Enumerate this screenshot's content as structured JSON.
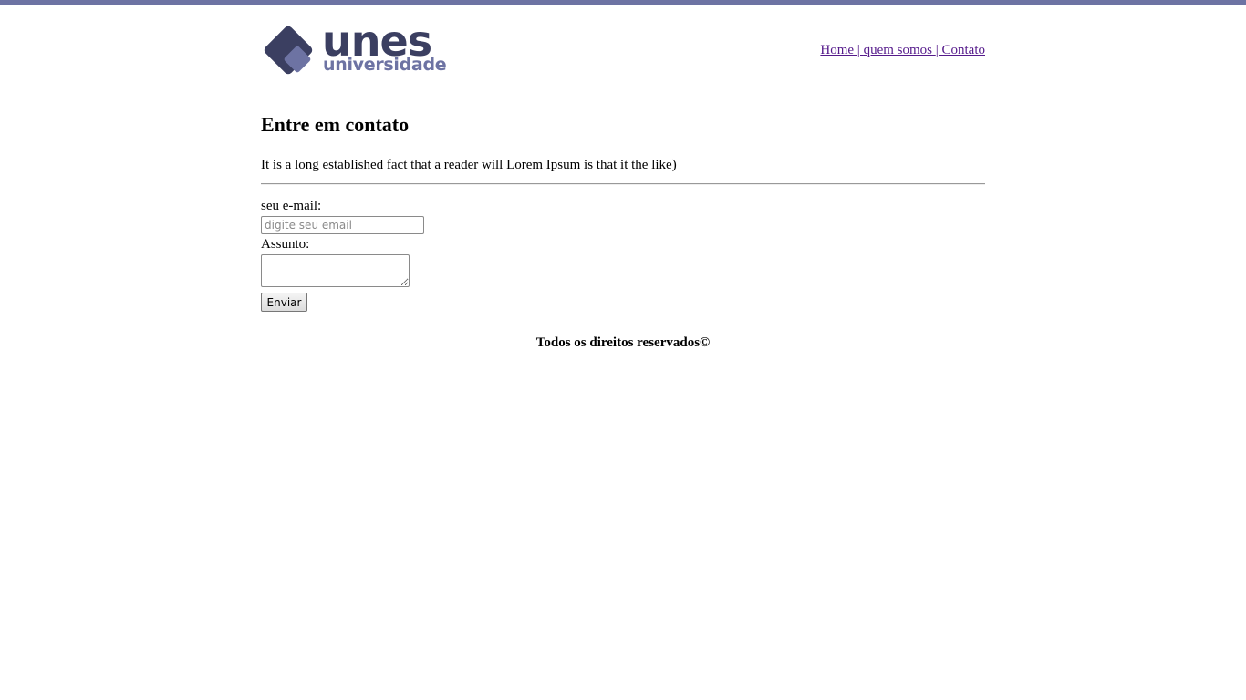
{
  "brand": {
    "name": "unes",
    "tagline": "universidade",
    "primary_color": "#3b3f61",
    "accent_color": "#6d73a3"
  },
  "nav": {
    "home": "Home ",
    "sep1": "| ",
    "about": "quem somos ",
    "sep2": "| ",
    "contact": "Contato"
  },
  "page": {
    "title": "Entre em contato",
    "intro": "It is a long established fact that a reader will Lorem Ipsum is that it the like)"
  },
  "form": {
    "email_label": "seu e-mail:",
    "email_placeholder": "digite seu email",
    "email_value": "",
    "subject_label": "Assunto:",
    "subject_value": "",
    "submit_label": "Enviar"
  },
  "footer": {
    "text": "Todos os direitos reservados©"
  }
}
